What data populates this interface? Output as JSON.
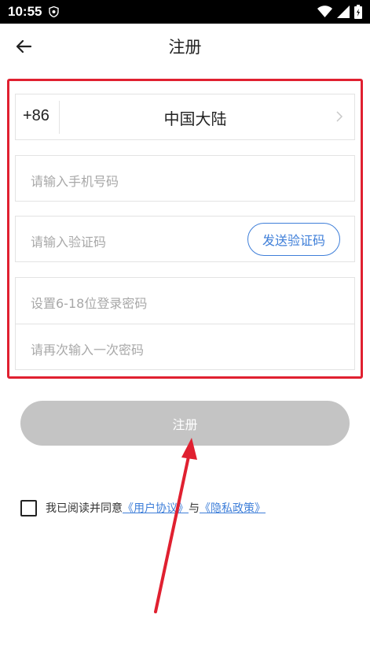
{
  "status_bar": {
    "time": "10:55"
  },
  "header": {
    "title": "注册"
  },
  "form": {
    "region": {
      "prefix": "+86",
      "country": "中国大陆"
    },
    "phone": {
      "placeholder": "请输入手机号码"
    },
    "code": {
      "placeholder": "请输入验证码",
      "send_label": "发送验证码"
    },
    "password": {
      "placeholder": "设置6-18位登录密码"
    },
    "password_confirm": {
      "placeholder": "请再次输入一次密码"
    }
  },
  "register_button": {
    "label": "注册"
  },
  "agreement": {
    "checked": false,
    "prefix": "我已阅读并同意",
    "user_agreement": "《用户协议》",
    "conjunction": "与",
    "privacy_policy": "《隐私政策》"
  },
  "colors": {
    "accent": "#3f7fd9",
    "highlight": "#e02030",
    "button_disabled": "#c4c4c4"
  },
  "icons": {
    "back": "arrow-left-icon",
    "chevron": "chevron-right-icon",
    "shield": "shield-icon",
    "wifi": "wifi-icon",
    "signal": "signal-icon",
    "battery": "battery-icon"
  }
}
